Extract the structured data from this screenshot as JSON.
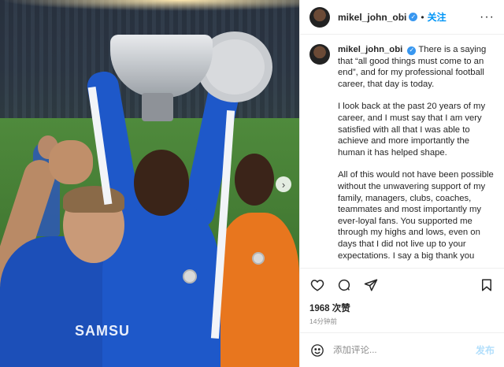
{
  "post": {
    "username": "mikel_john_obi",
    "follow_label": "关注",
    "separator": "•",
    "more_label": "···",
    "caption_paragraphs": [
      "There is a saying that “all good things must come to an end”, and for my professional football career, that day is today.",
      "I look back at the past 20 years of my career, and I must say that I am very satisfied with all that I was able to achieve and more importantly the human it has helped shape.",
      "All of this would not have been possible without the unwavering support of my family, managers, clubs, coaches, teammates and most importantly my ever-loyal fans. You supported me through my highs and lows, even on days that I did not live up to your expectations. I say a big thank you"
    ],
    "likes": "1968 次赞",
    "time_ago": "14分钟前",
    "comment_placeholder": "添加评论...",
    "post_label": "发布",
    "photo_shirt_text": "SAMSU",
    "next_label": "›"
  },
  "icons": {
    "like": "heart-icon",
    "comment": "comment-icon",
    "share": "paper-plane-icon",
    "save": "bookmark-icon",
    "emoji": "emoji-icon",
    "verified": "verified-badge-icon"
  },
  "colors": {
    "accent_blue": "#0095f6",
    "verified_blue": "#3897f0",
    "text": "#262626",
    "muted": "#8e8e8e",
    "post_disabled": "#b2dffc"
  }
}
